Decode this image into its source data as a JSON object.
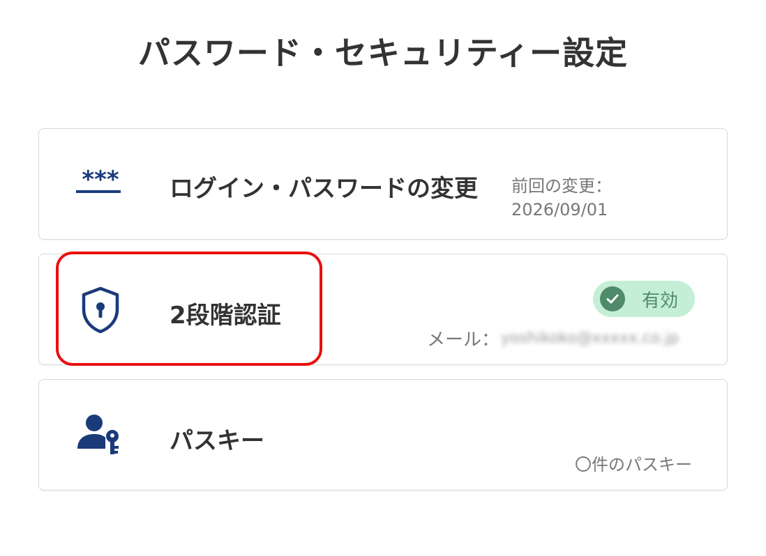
{
  "page": {
    "title": "パスワード・セキュリティー設定"
  },
  "colors": {
    "brand_navy": "#1a3a7a",
    "status_green_bg": "#c4efd6",
    "status_green": "#4f8a6a",
    "highlight_red": "#e8100f"
  },
  "cards": [
    {
      "icon": "password-asterisks-icon",
      "label": "ログイン・パスワードの変更",
      "meta_label": "前回の変更：",
      "meta_value": "2026/09/01"
    },
    {
      "icon": "shield-lock-icon",
      "label": "2段階認証",
      "status": "有効",
      "status_icon": "check-circle-icon",
      "email_label": "メール：",
      "email_value": "yoshikoko@xxxxx.co.jp"
    },
    {
      "icon": "user-key-icon",
      "label": "パスキー",
      "count_text": "〇件のパスキー"
    }
  ]
}
